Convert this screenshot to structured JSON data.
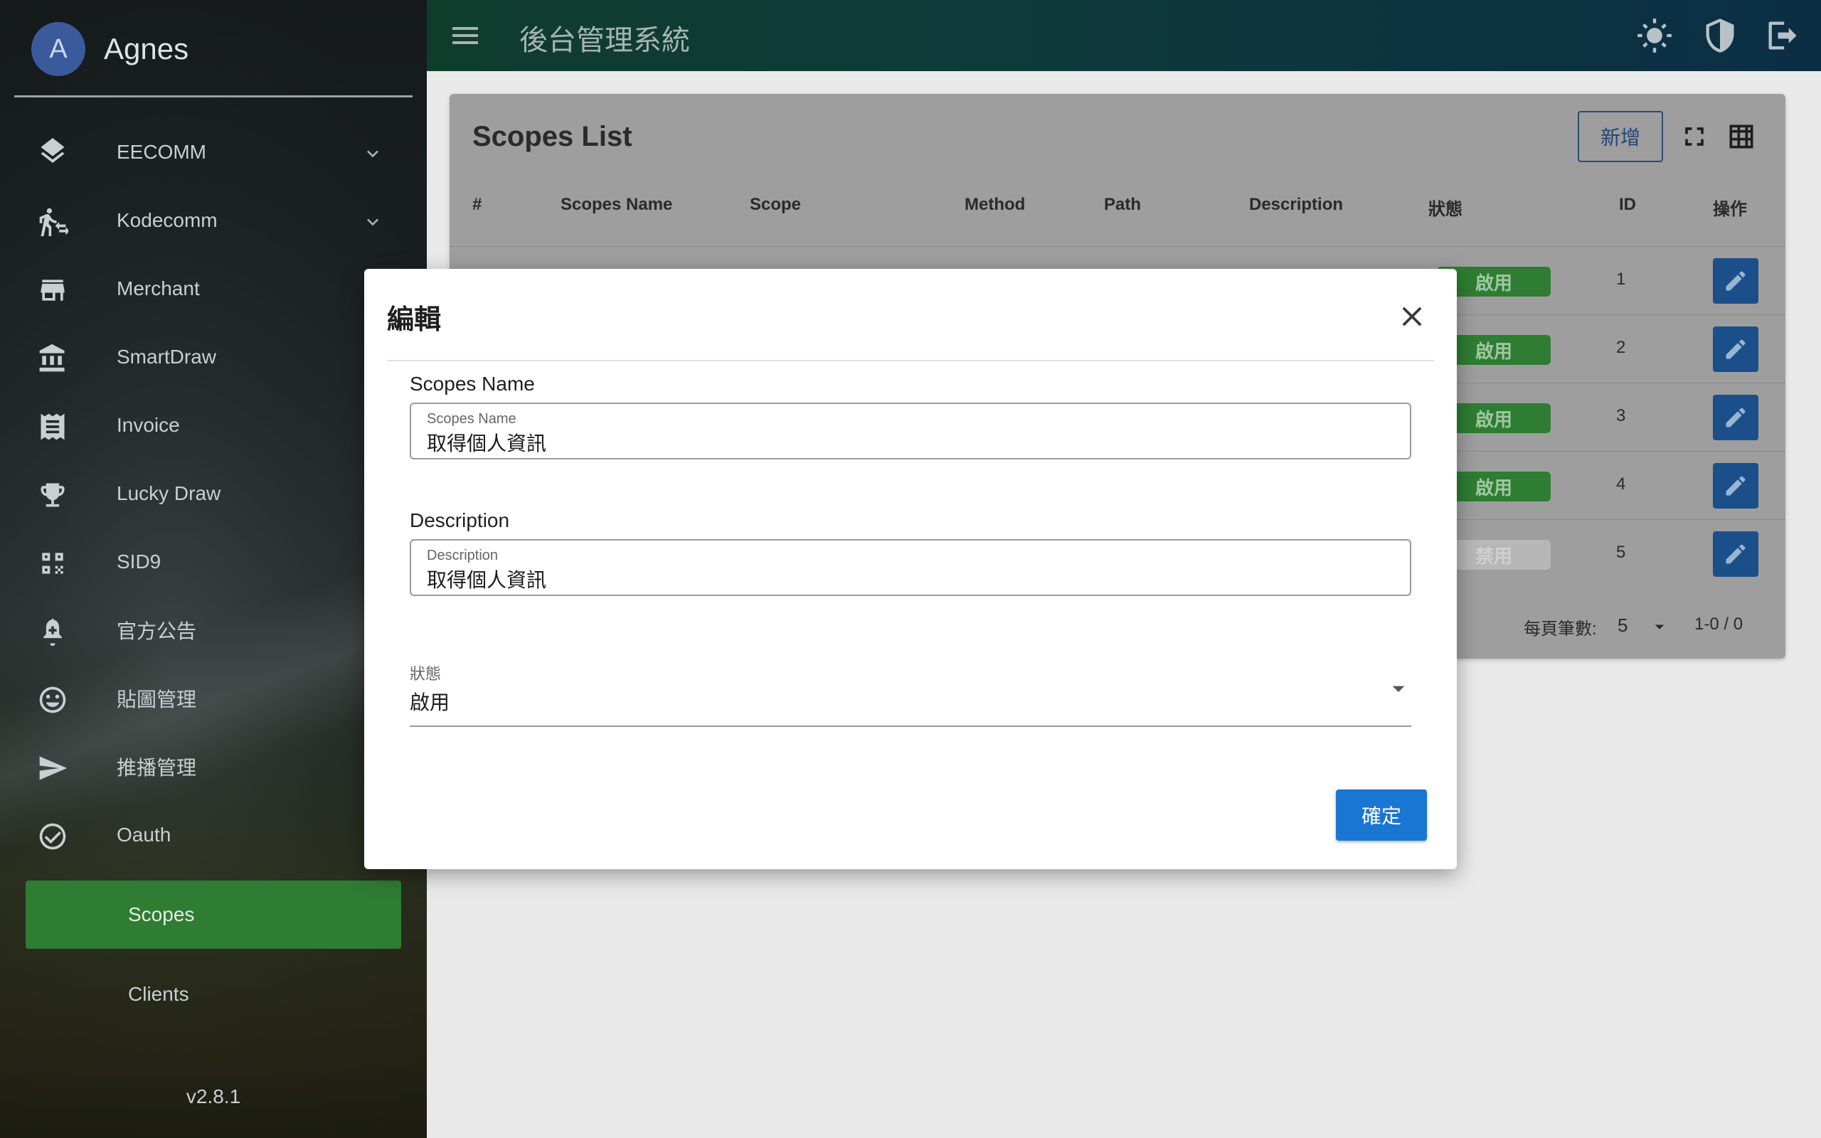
{
  "app": {
    "title": "後台管理系統",
    "version": "v2.8.1"
  },
  "profile": {
    "initial": "A",
    "name": "Agnes"
  },
  "sidebar": {
    "items": [
      {
        "label": "EECOMM",
        "icon": "layers-icon",
        "expandable": true
      },
      {
        "label": "Kodecomm",
        "icon": "walk-icon",
        "expandable": true
      },
      {
        "label": "Merchant",
        "icon": "store-icon"
      },
      {
        "label": "SmartDraw",
        "icon": "bank-icon"
      },
      {
        "label": "Invoice",
        "icon": "receipt-icon"
      },
      {
        "label": "Lucky Draw",
        "icon": "trophy-icon"
      },
      {
        "label": "SID9",
        "icon": "qr-scan-icon"
      },
      {
        "label": "官方公告",
        "icon": "bell-plus-icon"
      },
      {
        "label": "貼圖管理",
        "icon": "smiley-icon"
      },
      {
        "label": "推播管理",
        "icon": "send-icon"
      },
      {
        "label": "Oauth",
        "icon": "check-circle-icon"
      }
    ],
    "subitems": [
      {
        "label": "Scopes",
        "active": true
      },
      {
        "label": "Clients",
        "active": false
      }
    ]
  },
  "topbar": {
    "icons": [
      "brightness-icon",
      "shield-icon",
      "logout-icon"
    ]
  },
  "card": {
    "title": "Scopes List",
    "add_label": "新增",
    "columns": [
      "#",
      "Scopes Name",
      "Scope",
      "Method",
      "Path",
      "Description",
      "狀態",
      "ID",
      "操作"
    ],
    "rows": [
      {
        "status": "啟用",
        "id": "1",
        "enabled": true
      },
      {
        "status": "啟用",
        "id": "2",
        "enabled": true
      },
      {
        "status": "啟用",
        "id": "3",
        "enabled": true
      },
      {
        "status": "啟用",
        "id": "4",
        "enabled": true
      },
      {
        "status": "禁用",
        "id": "5",
        "enabled": false
      }
    ],
    "pager": {
      "label": "每頁筆數:",
      "per_page": "5",
      "range": "1-0 / 0"
    }
  },
  "dialog": {
    "title": "編輯",
    "name_title": "Scopes Name",
    "name_float": "Scopes Name",
    "name_value": "取得個人資訊",
    "desc_title": "Description",
    "desc_float": "Description",
    "desc_value": "取得個人資訊",
    "status_float": "狀態",
    "status_value": "啟用",
    "confirm_label": "確定"
  },
  "colors": {
    "active_nav": "#2e7d32",
    "primary_button": "#1976d2",
    "badge_enabled": "#2e7d32",
    "badge_disabled": "#b7b7b7"
  }
}
